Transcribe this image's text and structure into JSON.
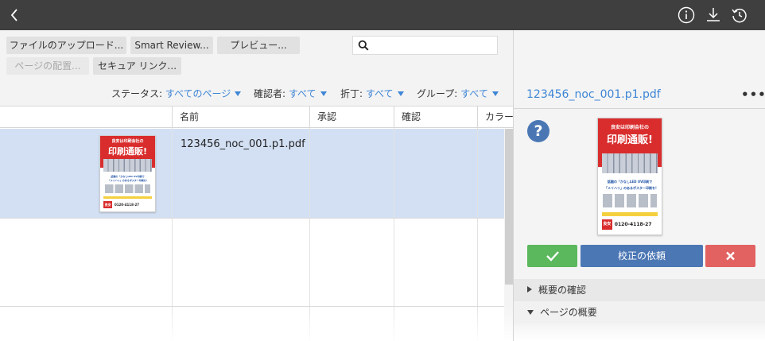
{
  "toolbar": {
    "upload_label": "ファイルのアップロード...",
    "smart_review_label": "Smart Review...",
    "preview_label": "プレビュー...",
    "page_placement_label": "ページの配置...",
    "secure_link_label": "セキュア リンク...",
    "search_placeholder": ""
  },
  "filters": [
    {
      "label": "ステータス: ",
      "value": "すべてのページ"
    },
    {
      "label": "確認者: ",
      "value": "すべて"
    },
    {
      "label": "折丁: ",
      "value": "すべて"
    },
    {
      "label": "グループ: ",
      "value": "すべて"
    }
  ],
  "table": {
    "columns": [
      "名前",
      "承認",
      "確認",
      "カラー"
    ],
    "rows": [
      {
        "name": "123456_noc_001.p1.pdf",
        "selected": true
      }
    ]
  },
  "poster": {
    "headline_small": "良安は印刷会社の",
    "headline": "印刷通販!",
    "blue_line1": "話題の「かなしLED UV印刷で",
    "blue_line2": "「メリハリ」のあるポスター印刷を!",
    "badge": "良安",
    "phone": "0120-4118-27"
  },
  "right_panel": {
    "file_title": "123456_noc_001.p1.pdf",
    "more_label": "•••",
    "question_label": "?",
    "request_label": "校正の依頼",
    "sections": [
      {
        "label": "概要の確認",
        "expanded": false
      },
      {
        "label": "ページの概要",
        "expanded": true
      }
    ]
  },
  "colors": {
    "topbar": "#3f3f3f",
    "accent_blue": "#3f86d6",
    "selected_row": "#d3e0f4",
    "approve_green": "#5bb85d",
    "request_blue": "#4b77b4",
    "reject_red": "#e26262"
  },
  "icons": {
    "back": "chevron-left-icon",
    "info": "info-icon",
    "download": "download-icon",
    "history": "history-icon",
    "search": "search-icon",
    "approve": "checkmark-icon",
    "reject": "close-icon",
    "help": "question-icon"
  }
}
